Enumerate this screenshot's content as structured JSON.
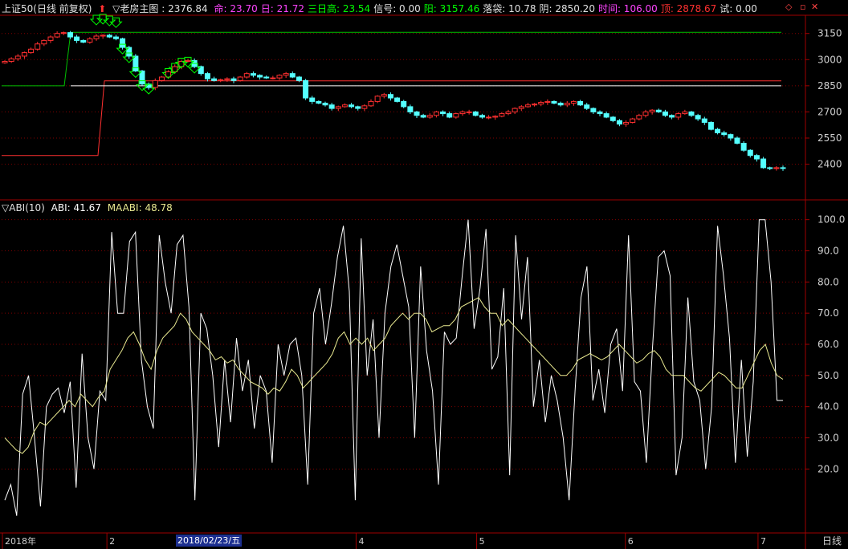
{
  "header": {
    "index_name": "上证50(日线 前复权)",
    "indicator_title": "▽老房主图 : 2376.84",
    "fields": [
      {
        "label": "命: 23.70",
        "color": "#ff44ff"
      },
      {
        "label": "日: 21.72",
        "color": "#ff44ff"
      },
      {
        "label": "三日高: 23.54",
        "color": "#00ff00"
      },
      {
        "label": "信号: 0.00",
        "color": "#e0e0e0"
      },
      {
        "label": "阳: 3157.46",
        "color": "#00ff00"
      },
      {
        "label": "落袋: 10.78",
        "color": "#e0e0e0"
      },
      {
        "label": "阴: 2850.20",
        "color": "#e0e0e0"
      },
      {
        "label": "时间: 106.00",
        "color": "#ff44ff"
      },
      {
        "label": "顶: 2878.67",
        "color": "#ff3030"
      },
      {
        "label": "试: 0.00",
        "color": "#e0e0e0"
      }
    ]
  },
  "sub_header": {
    "title": "▽ABI(10)",
    "abi": "ABI: 41.67",
    "maabi": "MAABI: 48.78"
  },
  "xaxis": {
    "labels": [
      {
        "text": "2018年",
        "pos": 0.0
      },
      {
        "text": "2",
        "pos": 0.13
      },
      {
        "text": "4",
        "pos": 0.44
      },
      {
        "text": "5",
        "pos": 0.59
      },
      {
        "text": "6",
        "pos": 0.775
      },
      {
        "text": "7",
        "pos": 0.94
      }
    ],
    "highlight": "2018/02/23/五",
    "period": "日线"
  },
  "colors": {
    "up": "#ff3030",
    "down": "#54ffff",
    "grid": "#800000",
    "axis": "#a00000",
    "abi": "#ffffff",
    "maabi": "#e8e890",
    "green_line": "#00c000",
    "red_line": "#ff3030",
    "white_line": "#ffffff",
    "arrow": "#00ff00"
  },
  "chart_data": [
    {
      "type": "candlestick",
      "title": "上证50(日线 前复权)",
      "y_ticks": [
        3150,
        3000,
        2850,
        2700,
        2550,
        2400
      ],
      "ylim": [
        2200,
        3250
      ],
      "close": [
        2990,
        3005,
        3020,
        3040,
        3060,
        3090,
        3110,
        3130,
        3150,
        3155,
        3130,
        3110,
        3100,
        3120,
        3135,
        3140,
        3130,
        3120,
        3070,
        3020,
        2935,
        2860,
        2840,
        2880,
        2900,
        2930,
        2960,
        2990,
        2995,
        2960,
        2920,
        2890,
        2880,
        2885,
        2890,
        2880,
        2900,
        2920,
        2910,
        2900,
        2895,
        2895,
        2910,
        2920,
        2900,
        2880,
        2780,
        2760,
        2750,
        2740,
        2720,
        2730,
        2740,
        2730,
        2720,
        2735,
        2760,
        2790,
        2800,
        2780,
        2760,
        2730,
        2700,
        2680,
        2670,
        2680,
        2700,
        2690,
        2670,
        2690,
        2700,
        2700,
        2680,
        2670,
        2670,
        2675,
        2690,
        2700,
        2720,
        2730,
        2740,
        2745,
        2755,
        2760,
        2750,
        2740,
        2750,
        2760,
        2740,
        2720,
        2700,
        2690,
        2670,
        2650,
        2630,
        2640,
        2660,
        2680,
        2700,
        2710,
        2700,
        2680,
        2670,
        2690,
        2700,
        2680,
        2660,
        2640,
        2600,
        2580,
        2570,
        2550,
        2520,
        2480,
        2450,
        2430,
        2380,
        2375,
        2380,
        2377
      ],
      "x_labels": [
        "2018年",
        "2",
        "4",
        "5",
        "6",
        "7"
      ]
    },
    {
      "type": "line",
      "title": "ABI(10)",
      "y_ticks": [
        100,
        90,
        80,
        70,
        60,
        50,
        40,
        30,
        20
      ],
      "ylim": [
        0,
        103
      ],
      "series": [
        {
          "name": "ABI",
          "values": [
            10,
            15,
            5,
            44,
            50,
            30,
            8,
            40,
            44,
            46,
            38,
            48,
            14,
            57,
            30,
            20,
            45,
            42,
            96,
            70,
            70,
            93,
            96,
            55,
            40,
            33,
            95,
            80,
            70,
            92,
            95,
            72,
            10,
            70,
            65,
            50,
            27,
            55,
            35,
            62,
            45,
            55,
            33,
            50,
            45,
            22,
            60,
            50,
            60,
            62,
            50,
            15,
            70,
            78,
            60,
            73,
            88,
            98,
            77,
            10,
            94,
            50,
            68,
            30,
            70,
            85,
            92,
            82,
            72,
            30,
            85,
            58,
            45,
            15,
            64,
            60,
            62,
            82,
            100,
            65,
            78,
            97,
            52,
            56,
            78,
            18,
            95,
            68,
            88,
            40,
            55,
            35,
            50,
            42,
            30,
            10,
            45,
            75,
            85,
            42,
            52,
            38,
            60,
            65,
            45,
            95,
            48,
            45,
            22,
            58,
            88,
            90,
            82,
            18,
            30,
            75,
            48,
            42,
            20,
            40,
            98,
            82,
            62,
            22,
            55,
            24,
            48,
            100,
            100,
            80,
            42,
            42
          ]
        },
        {
          "name": "MAABI",
          "values": [
            30,
            28,
            26,
            25,
            27,
            32,
            35,
            34,
            36,
            38,
            40,
            42,
            40,
            44,
            42,
            40,
            43,
            45,
            52,
            55,
            58,
            62,
            64,
            60,
            55,
            52,
            58,
            62,
            64,
            66,
            70,
            68,
            64,
            62,
            60,
            58,
            55,
            56,
            54,
            55,
            52,
            50,
            48,
            47,
            46,
            44,
            46,
            45,
            48,
            52,
            50,
            46,
            48,
            50,
            52,
            54,
            57,
            62,
            64,
            60,
            62,
            60,
            62,
            58,
            60,
            62,
            66,
            68,
            70,
            68,
            70,
            70,
            68,
            64,
            65,
            66,
            66,
            68,
            72,
            73,
            74,
            75,
            72,
            70,
            70,
            66,
            68,
            66,
            64,
            62,
            60,
            58,
            56,
            54,
            52,
            50,
            50,
            52,
            55,
            56,
            57,
            56,
            55,
            56,
            58,
            60,
            58,
            56,
            54,
            55,
            57,
            58,
            56,
            52,
            50,
            50,
            50,
            48,
            46,
            45,
            47,
            49,
            51,
            50,
            48,
            46,
            46,
            50,
            54,
            58,
            60,
            54,
            50,
            48.78
          ]
        }
      ]
    }
  ]
}
